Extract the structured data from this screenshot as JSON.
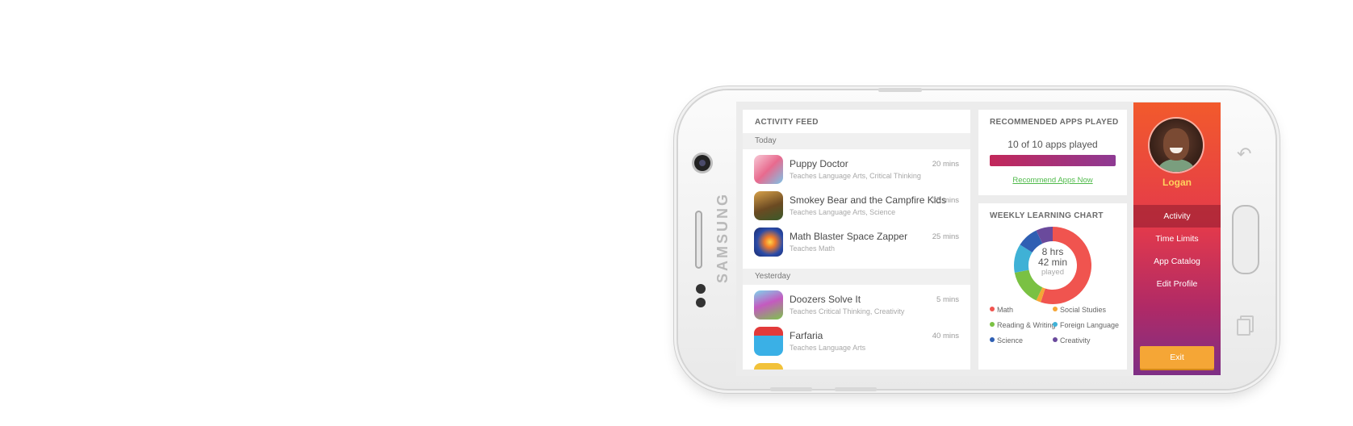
{
  "device": {
    "brand": "SAMSUNG"
  },
  "activity_feed": {
    "title": "ACTIVITY FEED",
    "groups": [
      {
        "label": "Today",
        "items": [
          {
            "name": "Puppy Doctor",
            "teaches": "Teaches Language Arts, Critical Thinking",
            "time": "20 mins",
            "icon": "puppy-doctor-app-icon"
          },
          {
            "name": "Smokey Bear and the Campfire Kids",
            "teaches": "Teaches Language Arts, Science",
            "time": "35 mins",
            "icon": "smokey-bear-app-icon"
          },
          {
            "name": "Math Blaster Space Zapper",
            "teaches": "Teaches Math",
            "time": "25 mins",
            "icon": "math-blaster-app-icon"
          }
        ]
      },
      {
        "label": "Yesterday",
        "items": [
          {
            "name": "Doozers Solve It",
            "teaches": "Teaches Critical Thinking, Creativity",
            "time": "5 mins",
            "icon": "doozers-app-icon"
          },
          {
            "name": "Farfaria",
            "teaches": "Teaches Language Arts",
            "time": "40 mins",
            "icon": "farfaria-app-icon"
          }
        ]
      }
    ]
  },
  "recommended": {
    "title": "RECOMMENDED APPS PLAYED",
    "count_text": "10 of 10 apps played",
    "progress": 1.0,
    "link": "Recommend Apps Now"
  },
  "weekly": {
    "title": "WEEKLY LEARNING CHART",
    "center_line1": "8 hrs",
    "center_line2": "42 min",
    "center_line3": "played",
    "legend": [
      {
        "label": "Math",
        "color": "#f0544f"
      },
      {
        "label": "Social Studies",
        "color": "#f5a636"
      },
      {
        "label": "Reading & Writing",
        "color": "#7ac143"
      },
      {
        "label": "Foreign Language",
        "color": "#3fb1d6"
      },
      {
        "label": "Science",
        "color": "#2f5fb3"
      },
      {
        "label": "Creativity",
        "color": "#6a4a9c"
      }
    ],
    "segments": [
      {
        "category": "Math",
        "share": 0.55
      },
      {
        "category": "Social Studies",
        "share": 0.02
      },
      {
        "category": "Reading & Writing",
        "share": 0.15
      },
      {
        "category": "Foreign Language",
        "share": 0.12
      },
      {
        "category": "Science",
        "share": 0.09
      },
      {
        "category": "Creativity",
        "share": 0.07
      }
    ]
  },
  "sidebar": {
    "user_name": "Logan",
    "nav": [
      "Activity",
      "Time Limits",
      "App Catalog",
      "Edit Profile"
    ],
    "active": "Activity",
    "exit_label": "Exit"
  }
}
